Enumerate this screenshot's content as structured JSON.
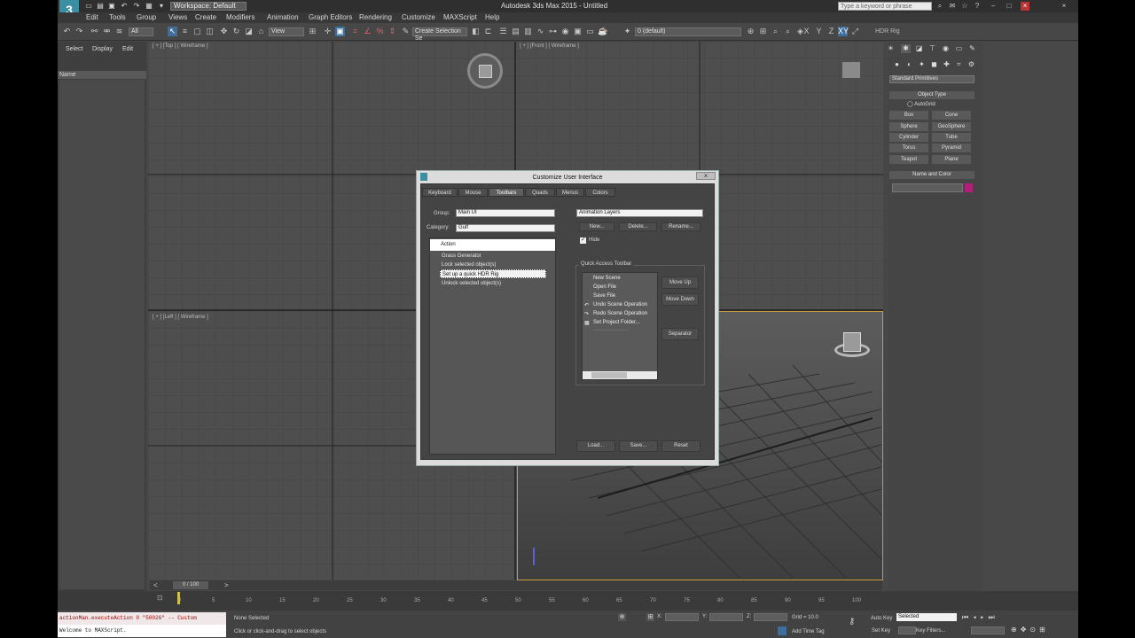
{
  "window": {
    "title": "Autodesk 3ds Max 2015 - Untitled",
    "workspace": "Workspace: Default",
    "search_placeholder": "Type a keyword or phrase"
  },
  "menus": [
    "Edit",
    "Tools",
    "Group",
    "Views",
    "Create",
    "Modifiers",
    "Animation",
    "Graph Editors",
    "Rendering",
    "Customize",
    "MAXScript",
    "Help"
  ],
  "toolbar": {
    "selection_filter": "All",
    "ref_coord": "View",
    "named_sel": "Create Selection Se",
    "layer": "0 (default)",
    "extra_tab": "HDR Rig"
  },
  "explorer": {
    "tabs": [
      "Select",
      "Display",
      "Edit"
    ],
    "header": "Name"
  },
  "viewports": {
    "top": "[ + ] [Top ] [ Wireframe ]",
    "front": "[ + ] [Front ] [ Wireframe ]",
    "left": "[ + ] [Left ] [ Wireframe ]"
  },
  "command_panel": {
    "category": "Standard Primitives",
    "object_type_title": "Object Type",
    "autogrid": "AutoGrid",
    "primitives": [
      "Box",
      "Cone",
      "Sphere",
      "GeoSphere",
      "Cylinder",
      "Tube",
      "Torus",
      "Pyramid",
      "Teapot",
      "Plane"
    ],
    "name_color_title": "Name and Color",
    "name_color_swatch": "#b0207a"
  },
  "dialog": {
    "title": "Customize User Interface",
    "tabs": [
      "Keyboard",
      "Mouse",
      "Toolbars",
      "Quads",
      "Menus",
      "Colors"
    ],
    "group_label": "Group:",
    "group_value": "Main UI",
    "category_label": "Category:",
    "category_value": "Gulf",
    "action_header": "Action",
    "actions": [
      "Grass Generator",
      "Lock selected object(s)",
      "Set up a quick HDR Rig",
      "Unlock selected object(s)"
    ],
    "toolbar_select": "Animation Layers",
    "buttons": {
      "new": "New...",
      "delete": "Delete...",
      "rename": "Rename...",
      "move_up": "Move Up",
      "move_down": "Move Down",
      "separator": "Separator",
      "load": "Load...",
      "save": "Save...",
      "reset": "Reset"
    },
    "hide_label": "Hide",
    "qat_title": "Quick Access Toolbar",
    "qat_items": [
      "New Scene",
      "Open File",
      "Save File",
      "Undo Scene Operation",
      "Redo Scene Operation",
      "Set Project Folder...",
      "--------------------"
    ]
  },
  "timeline": {
    "slider": "0 / 100",
    "ticks": [
      "0",
      "5",
      "10",
      "15",
      "20",
      "25",
      "30",
      "35",
      "40",
      "45",
      "50",
      "55",
      "60",
      "65",
      "70",
      "75",
      "80",
      "85",
      "90",
      "95",
      "100"
    ]
  },
  "listener": {
    "line1": "actionMan.executeAction 0 \"50026\"  -- Custom",
    "line2": "Welcome to MAXScript."
  },
  "status": {
    "selection": "None Selected",
    "prompt": "Click or click-and-drag to select objects",
    "x_label": "X:",
    "y_label": "Y:",
    "z_label": "Z:",
    "grid": "Grid = 10.0",
    "add_time_tag": "Add Time Tag",
    "auto_key": "Auto Key",
    "selected_mode": "Selected",
    "set_key": "Set Key",
    "key_filters": "Key Filters..."
  }
}
